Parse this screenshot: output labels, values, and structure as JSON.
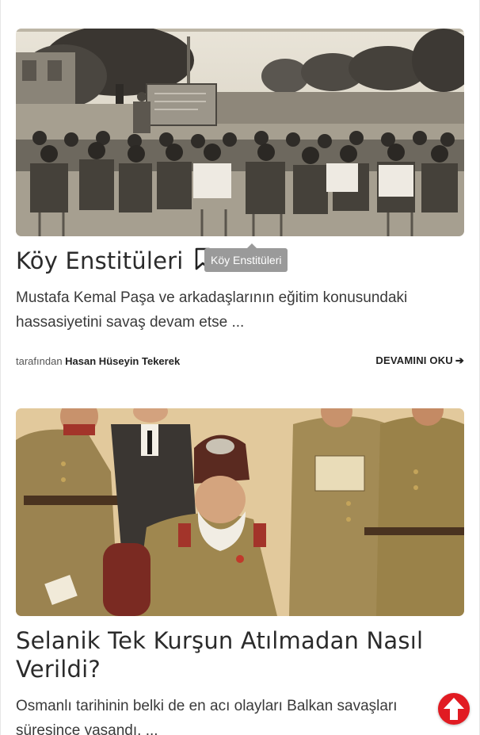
{
  "articles": [
    {
      "image_alt": "Köy Enstitüleri",
      "title": "Köy Enstitüleri",
      "tooltip": "Köy Enstitüleri",
      "excerpt": "Mustafa Kemal Paşa ve arkadaşlarının eğitim konusundaki hassasiyetini savaş devam etse ...",
      "by_label": "tarafından",
      "author": "Hasan Hüseyin Tekerek",
      "read_more": "DEVAMINI OKU",
      "read_more_icon": "arrow-right-icon"
    },
    {
      "image_alt": "Selanik Tek Kurşun Atılmadan Nasıl Verildi?",
      "title": "Selanik Tek Kurşun Atılmadan Nasıl Verildi?",
      "excerpt": "Osmanlı tarihinin belki de en acı olayları Balkan savaşları süresince yaşandı. ..."
    }
  ],
  "scroll_top": {
    "icon": "arrow-up-icon",
    "color": "#e11b22"
  },
  "colors": {
    "text": "#333333",
    "tooltip_bg": "#9a9a9a"
  }
}
